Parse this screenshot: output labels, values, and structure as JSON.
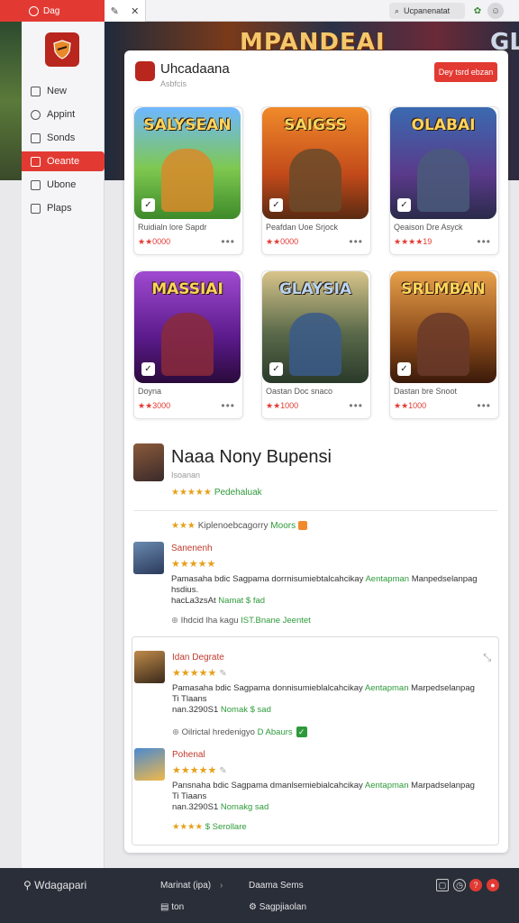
{
  "tabs": {
    "active_label": "Dag",
    "pin_icon": "pin-icon",
    "close_icon": "close-icon"
  },
  "search": {
    "value": "Ucpanenatat"
  },
  "banner": {
    "title": "MPANDEAI",
    "title2": "GLASS"
  },
  "sidebar": {
    "items": [
      {
        "label": "New"
      },
      {
        "label": "Appint"
      },
      {
        "label": "Sonds"
      },
      {
        "label": "Oeante"
      },
      {
        "label": "Ubone"
      },
      {
        "label": "Plaps"
      }
    ]
  },
  "app": {
    "title": "Uhcadaana",
    "subtitle": "Asbfcis",
    "action_button": "Dey tsrd ebzan"
  },
  "games": [
    {
      "title": "SALYSEAN",
      "name": "Ruidialn lore Sapdr",
      "rating": "★★0000"
    },
    {
      "title": "SAIGSS",
      "name": "Peafdan Uoe Srjock",
      "rating": "★★0000"
    },
    {
      "title": "OLABAI",
      "name": "Qeaison Dre Asyck",
      "rating": "★★★★19"
    },
    {
      "title": "MASSIAI",
      "name": "Doyna",
      "rating": "★★3000"
    },
    {
      "title": "GLAYSIA",
      "name": "Oastan Doc snaco",
      "rating": "★★1000"
    },
    {
      "title": "SRLMBAN",
      "name": "Dastan bre Snoot",
      "rating": "★★1000"
    }
  ],
  "featured": {
    "title": "Naaa Nony Bupensi",
    "subtitle": "Isoanan",
    "stars": "★★★★★",
    "rating_text": "Pedehaluak",
    "meta_prefix": "★★★",
    "meta_text": "Kiplenoebcagorry",
    "meta_link": "Moors"
  },
  "reviews": [
    {
      "name": "Sanenenh",
      "stars": "★★★★★",
      "body": "Pamasaha bdic Sagpama dorrnisumiebtalcahcikay",
      "body_link": "Aentapman",
      "body_tail": "Manpedselanpag",
      "body2": "hsdius.",
      "meta": "hacLa3zsAt",
      "meta_link": "Namat $ fad",
      "foot": "Ihdcid lha kagu",
      "foot_link": "IST.Bnane Jeentet"
    },
    {
      "name": "Idan Degrate",
      "stars": "★★★★★",
      "body": "Pamasaha bdic Sagpama donnisumieblalcahcikay",
      "body_link": "Aentapman",
      "body_tail": "Marpedselanpag",
      "body2": "Ti Tlaans",
      "meta": "nan.3290S1",
      "meta_link": "Nomak $ sad",
      "foot": "Oilrictal hredenigyo",
      "foot_link": "D Abaurs"
    },
    {
      "name": "Pohenal",
      "stars": "★★★★★",
      "body": "Pansnaha bdic Sagpama dmanlsemiebialcahcikay",
      "body_link": "Aentapman",
      "body_tail": "Marpadselanpag",
      "body2": "Ti Tiaans",
      "meta": "nan.3290S1",
      "meta_link": "Nomakg sad",
      "foot_stars": "★★★★",
      "foot": "$ Serollare"
    }
  ],
  "bottom": {
    "brand": "Wdagapari",
    "col1_a": "Marinat (ipa)",
    "col1_b": "ton",
    "col2_a": "Daama Sems",
    "col2_b": "Sagpjiaolan"
  },
  "colors": {
    "accent": "#e23a33",
    "star": "#e6a01a",
    "link_green": "#2e9a3a",
    "bottom_bar": "#2a2e38"
  }
}
